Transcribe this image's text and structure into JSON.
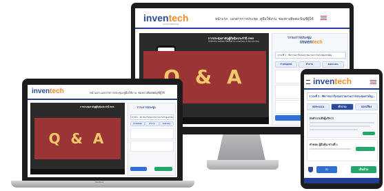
{
  "brand": {
    "logo_main": "inven",
    "logo_accent": "tech",
    "logo_sub": "GOOD SERVICE"
  },
  "nav": [
    "หน้าแรก",
    "เอกสารการประชุม",
    "คู่มือใช้งาน",
    "ช่องทางติดต่อ",
    "บัญชีผู้ใช้"
  ],
  "slide": {
    "text": "Q & A"
  },
  "meeting": {
    "title": "การประชุมสามัญผู้ถือหุ้นประจำปี 2565",
    "subtitle": "บริษัท อินเวนท์เทค ซิสเต็มส์ (ประเทศไทย) จำกัด (มหาชน)"
  },
  "side_panel": {
    "header": "วาระการประชุม",
    "agenda_label": "วาระที่ 1 : พิจารณารับรองรายงานการประชุมสามัญ...",
    "tabs": [
      "ถ่ายทอดสด",
      "คำถาม",
      "ลงคะแนน"
    ]
  },
  "tablet": {
    "agenda_label": "วาระที่ 1 : พิจารณารับรองรายงานการประชุมสามัญ...",
    "tabs": [
      "ลงคะแนน",
      "คำถาม",
      "ออกเสียง"
    ],
    "question_title": "ส่งคำถามถึงผู้บริหาร",
    "answer_title": "คำตอบ ผู้ถือหุ้น ท่านที่ 1",
    "vote_approve": "เห็นด้วย",
    "send": "ส่ง"
  },
  "laptop": {
    "model": "MacBook"
  },
  "colors": {
    "slide_bg": "#9b3434",
    "accent": "#2c4a9a",
    "nav_bar": "#1f3f8f"
  }
}
